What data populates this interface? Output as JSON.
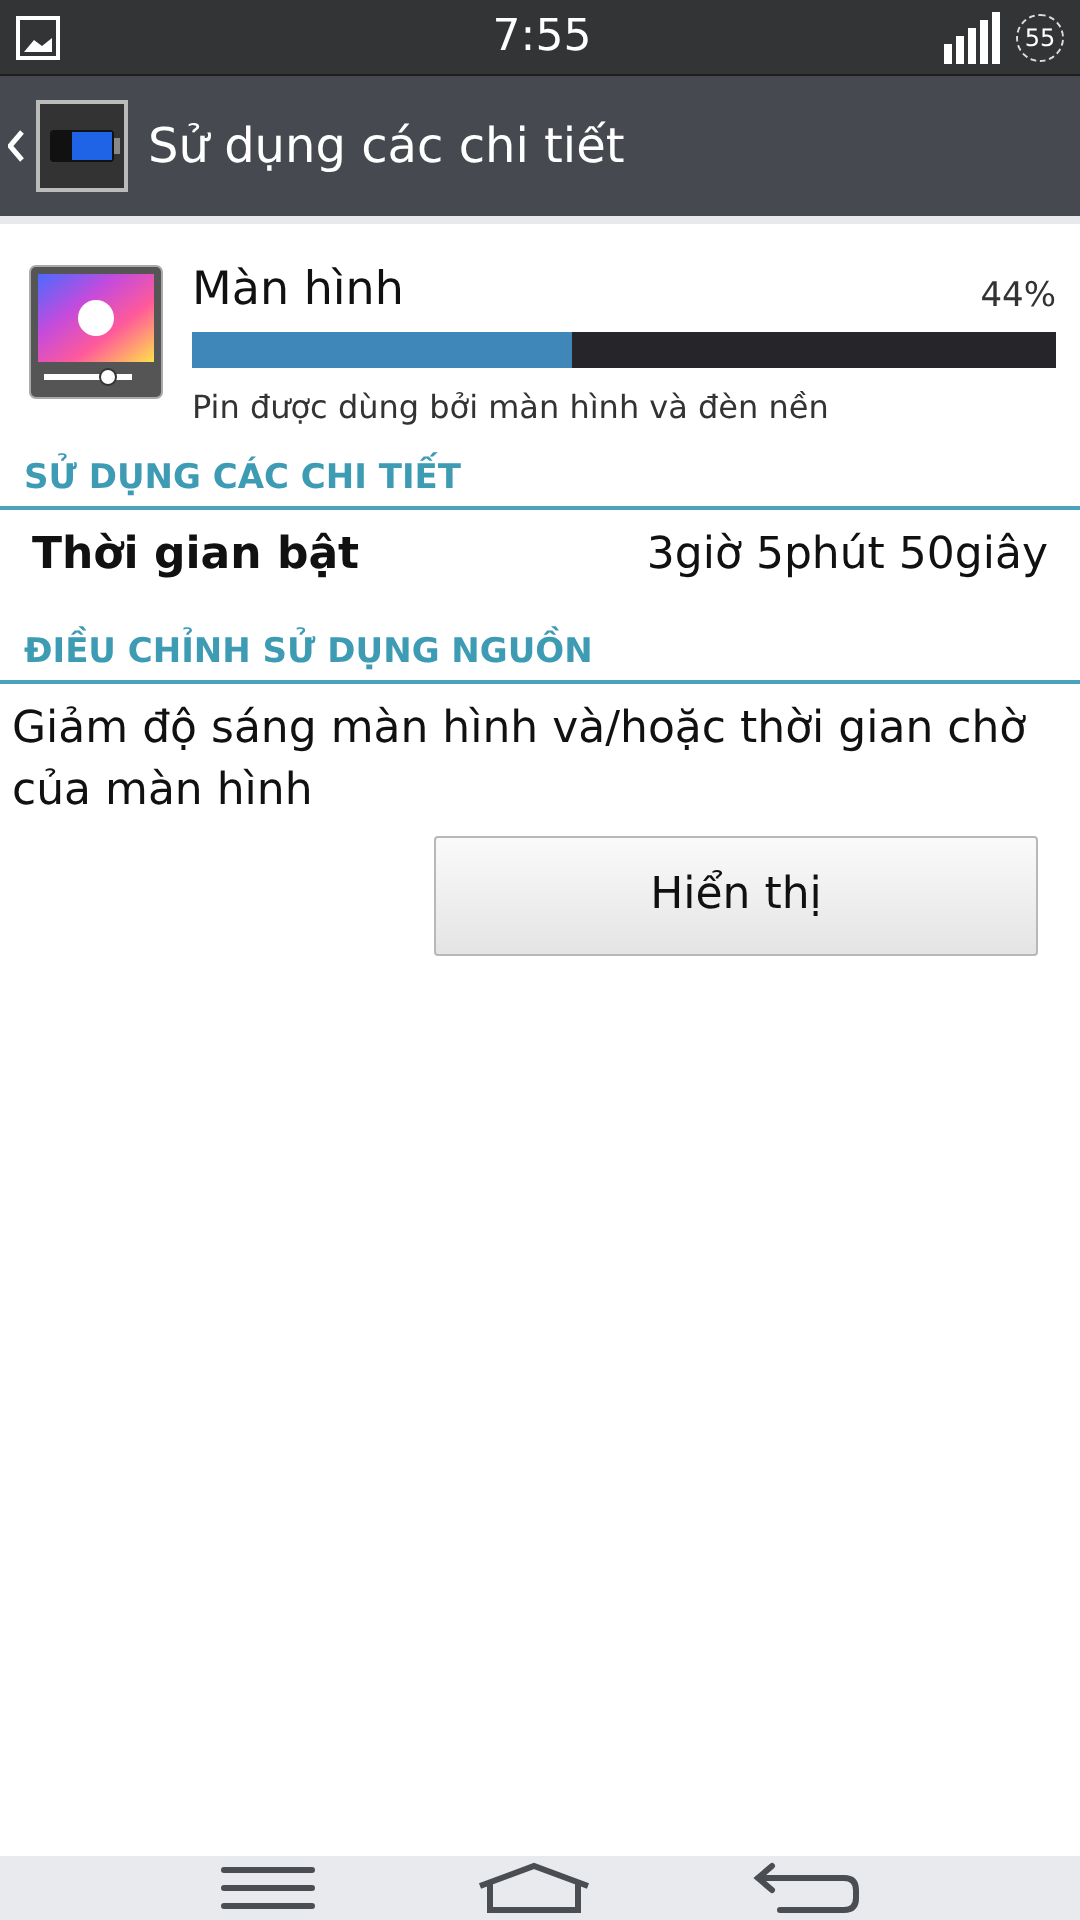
{
  "status_bar": {
    "time": "7:55",
    "battery": "55"
  },
  "action_bar": {
    "title": "Sử dụng các chi tiết"
  },
  "usage": {
    "name": "Màn hình",
    "percent": "44%",
    "level": 0.44,
    "description": "Pin được dùng bởi màn hình và đèn nền"
  },
  "sections": [
    {
      "header": "SỬ DỤNG CÁC CHI TIẾT",
      "kind": "row",
      "label": "Thời gian bật",
      "value": "3giờ 5phút 50giây"
    },
    {
      "header": "ĐIỀU CHỈNH SỬ DỤNG NGUỒN",
      "kind": "action",
      "text": "Giảm độ sáng màn hình và/hoặc thời gian chờ của màn hình",
      "button": "Hiển thị"
    }
  ]
}
